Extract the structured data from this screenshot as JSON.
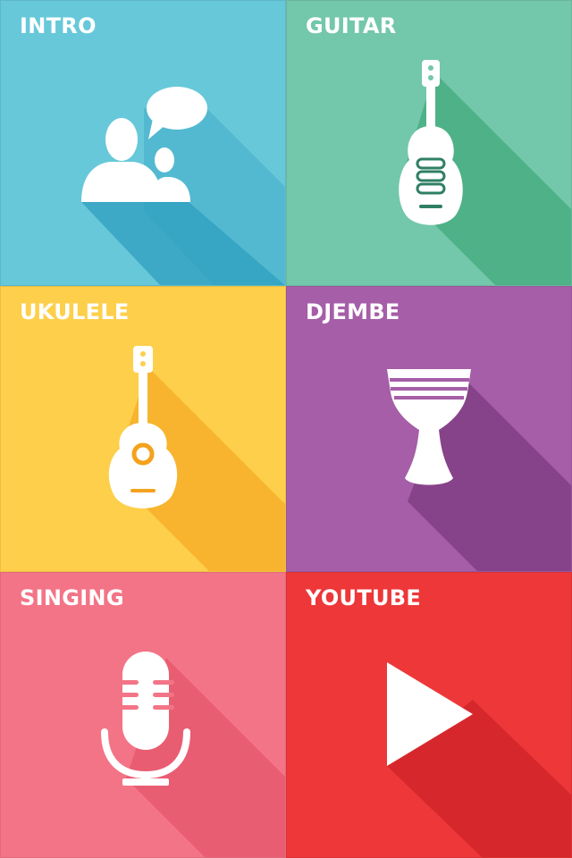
{
  "tiles": [
    {
      "id": "intro",
      "label": "INTRO",
      "color": "#67c8d9",
      "shadow": "#2f9fbf",
      "icon": "people-chat-icon"
    },
    {
      "id": "guitar",
      "label": "GUITAR",
      "color": "#73c7ab",
      "shadow": "#2f9f6c",
      "icon": "guitar-icon"
    },
    {
      "id": "ukulele",
      "label": "UKULELE",
      "color": "#fecf4a",
      "shadow": "#f4a21d",
      "icon": "ukulele-icon"
    },
    {
      "id": "djembe",
      "label": "DJEMBE",
      "color": "#a55ea7",
      "shadow": "#6f2e73",
      "icon": "djembe-icon"
    },
    {
      "id": "singing",
      "label": "SINGING",
      "color": "#f37486",
      "shadow": "#e0455f",
      "icon": "microphone-icon"
    },
    {
      "id": "youtube",
      "label": "YOUTUBE",
      "color": "#ee3738",
      "shadow": "#c61e25",
      "icon": "play-icon"
    }
  ]
}
